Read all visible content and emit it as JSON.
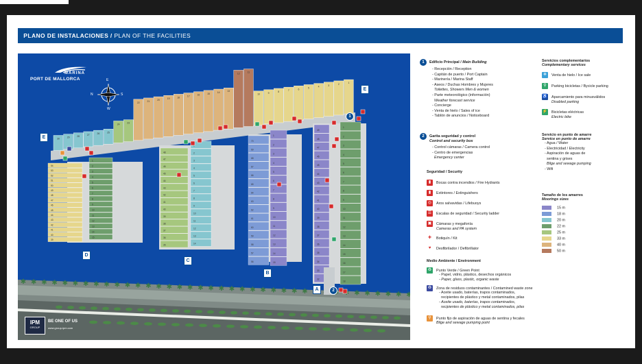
{
  "header": {
    "title_es": "PLANO DE INSTALACIONES /",
    "title_en": " PLAN OF THE FACILITIES"
  },
  "logo": {
    "name_top": "MARINA",
    "name_bottom": "PORT DE MALLORCA"
  },
  "compass": {
    "n": "N",
    "s": "S",
    "e": "E",
    "w": "W"
  },
  "zones": {
    "e_left": "E",
    "e_right": "E",
    "d": "D",
    "c": "C",
    "b": "B",
    "a": "A"
  },
  "berths": {
    "top_row": [
      "30",
      "29",
      "28",
      "27",
      "26",
      "25",
      "24",
      "23",
      "22",
      "21",
      "20",
      "19",
      "18",
      "17",
      "16",
      "15",
      "14",
      "13",
      "12",
      "11",
      "10",
      "9",
      "8",
      "7",
      "6",
      "5",
      "4",
      "3",
      "2",
      "1"
    ],
    "d_left": [
      "54",
      "53",
      "52",
      "51",
      "50",
      "49",
      "48",
      "47",
      "46",
      "45",
      "44",
      "43",
      "42",
      "41",
      "40",
      "39"
    ],
    "d_right": [
      "1",
      "2",
      "3",
      "4",
      "5",
      "6",
      "7",
      "8",
      "9",
      "10",
      "11",
      "12",
      "13",
      "14",
      "15"
    ],
    "c_left": [
      "48",
      "47",
      "46",
      "45",
      "44",
      "43",
      "42",
      "41",
      "40",
      "39",
      "38",
      "37",
      "36",
      "35"
    ],
    "c_right": [
      "1",
      "2",
      "3",
      "4",
      "5",
      "6",
      "7",
      "8",
      "9",
      "10",
      "11",
      "12",
      "13",
      "14"
    ],
    "b_left": [
      "70",
      "69",
      "68",
      "67",
      "66",
      "65",
      "64",
      "63",
      "62",
      "61",
      "60",
      "59",
      "58",
      "57",
      "56"
    ],
    "b_right": [
      "1",
      "2",
      "3",
      "4",
      "5",
      "6",
      "7",
      "8",
      "9",
      "10",
      "11",
      "12",
      "13",
      "14",
      "15"
    ],
    "a_left": [
      "49",
      "48",
      "47",
      "46",
      "45",
      "44",
      "43",
      "42",
      "41",
      "40",
      "39",
      "38",
      "37",
      "36",
      "35",
      "34",
      "33",
      "32"
    ],
    "a_right": [
      "1",
      "2",
      "3",
      "4",
      "5",
      "6",
      "7",
      "8",
      "9",
      "10",
      "11",
      "12",
      "13",
      "14",
      "15",
      "16",
      "17",
      "18"
    ]
  },
  "legend": {
    "main_building": {
      "num": "1",
      "title": "Edificio Principal / ",
      "title_en": "Main Building",
      "items": [
        "- Recepción / Reception",
        "- Capitán de puerto / Port Captain",
        "- Marinería / Marina Staff",
        "- Aseos / Duchas Hombres y Mujeres",
        "  Toilettes, Showers Men & women",
        "- Parte meteorológico (información)",
        "  Weather forecast service",
        "- Concierge",
        "- Venta de hielo / Sales of ice",
        "- Tablón de anuncios / Noticeboard"
      ]
    },
    "security_box": {
      "num": "2",
      "title": "Garita seguridad y control",
      "title_en": "Control and security box",
      "items": [
        "- Control cámaras / Camera control",
        "- Centro de emergencias",
        "  Emergency center"
      ]
    },
    "security": {
      "title": "Seguridad / Security",
      "items": [
        {
          "label": "Bocas contra incendios / Fire Hydrants",
          "color": "#d62b2b"
        },
        {
          "label": "Extintores / Extinguishers",
          "color": "#d62b2b"
        },
        {
          "label": "Aros salvavidas / Lifebuoys",
          "color": "#d62b2b"
        },
        {
          "label": "Escalas de seguridad / Security ladder",
          "color": "#d62b2b"
        },
        {
          "label": "Cámaras y megafonía",
          "label2": "Cameras and PA system",
          "color": "#d62b2b"
        },
        {
          "label": "Botiquín / Kit",
          "color": "#d62b2b"
        },
        {
          "label": "Desfibrilador / Defibrillator",
          "color": "#d62b2b"
        }
      ]
    },
    "environment": {
      "title": "Medio Ambiente / Environment",
      "green_point": {
        "title": "Punto Verde / Green Point",
        "l1": "- Papel, vidrio, plástico, desechos orgánicos",
        "l2": "- Paper, glass, plastic, organic waste"
      },
      "waste": {
        "title": "Zona de residuos contaminantes / Contamined waste zone",
        "l1": "- Aceite usado, baterías, trapos contaminados,",
        "l2": "  recipientes de plástico y metal contaminados, pilas",
        "l3": "- Aceite usado, baterías, trapos contaminados,",
        "l4": "  recipientes de plástico y metal contaminados, pilas"
      },
      "pump": {
        "title": "Punto fijo de aspiración de aguas de sentina y fecales",
        "l2": "Bilge and sewage pumping point"
      }
    },
    "complementary": {
      "title": "Servicios complementarios",
      "title_en": "Complementary services",
      "items": [
        {
          "label": "Venta de hielo / Ice sale",
          "color": "#3aa0d8"
        },
        {
          "label": "Parking bicicletas / Bycicle parking",
          "color": "#2fa56a"
        },
        {
          "label": "Aparcamiento para minusválidos",
          "label2": "Disabled parking",
          "color": "#1f4fa0"
        },
        {
          "label": "Bicicletas eléctricas",
          "label2": "Electric bike",
          "color": "#2fa56a"
        }
      ]
    },
    "mooring_service": {
      "title": "Servicio en punto de amarre",
      "title_en": "Service en punto de amarre",
      "items": [
        "- Agua / Water",
        "- Electricidad / Electricity",
        "- Aspiración de aguas de",
        "  sentina y grises",
        "  Bilge and sewage pumping",
        "- Wifi"
      ]
    },
    "sizes": {
      "title": "Tamaño de los amarres",
      "title_en": "Moorings sizes",
      "items": [
        {
          "label": "15 m",
          "color": "#8b86c9"
        },
        {
          "label": "18 m",
          "color": "#7d9bd6"
        },
        {
          "label": "20 m",
          "color": "#86c6cf"
        },
        {
          "label": "22 m",
          "color": "#6e9e6c"
        },
        {
          "label": "25 m",
          "color": "#a6c77e"
        },
        {
          "label": "33 m",
          "color": "#e6d68c"
        },
        {
          "label": "40 m",
          "color": "#ddb47c"
        },
        {
          "label": "50 m",
          "color": "#b57a5e"
        }
      ]
    }
  },
  "footer": {
    "ipm": "IPM",
    "group": "GROUP",
    "slogan": "BE ONE OF US",
    "url": "www.group-ipm.com"
  }
}
